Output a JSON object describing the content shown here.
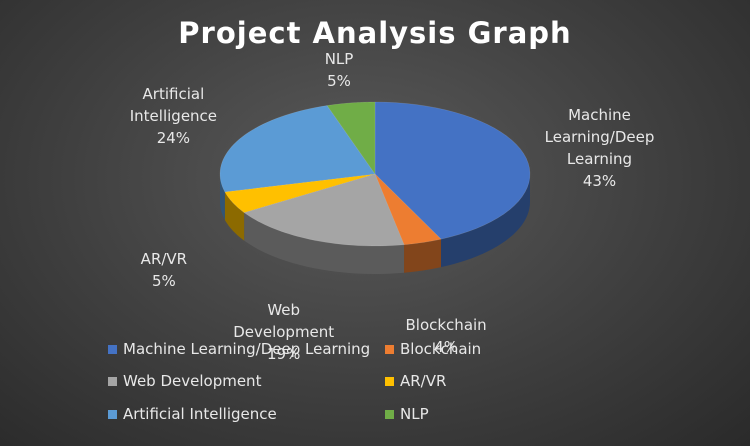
{
  "chart_data": {
    "type": "pie",
    "title": "Project Analysis Graph",
    "categories": [
      "Machine Learning/Deep Learning",
      "Blockchain",
      "Web Development",
      "AR/VR",
      "Artificial Intelligence",
      "NLP"
    ],
    "values": [
      43,
      4,
      19,
      5,
      24,
      5
    ],
    "value_labels": [
      "43%",
      "4%",
      "19%",
      "5%",
      "24%",
      "5%"
    ],
    "slice_labels": [
      [
        "Machine",
        "Learning/Deep",
        "Learning"
      ],
      [
        "Blockchain"
      ],
      [
        "Web",
        "Development"
      ],
      [
        "AR/VR"
      ],
      [
        "Artificial",
        "Intelligence"
      ],
      [
        "NLP"
      ]
    ],
    "colors": [
      "#4472C4",
      "#ED7D31",
      "#A5A5A5",
      "#FFC000",
      "#5B9BD5",
      "#70AD47"
    ],
    "legend_position": "bottom",
    "style": "3d-pie",
    "background": "#404040"
  }
}
